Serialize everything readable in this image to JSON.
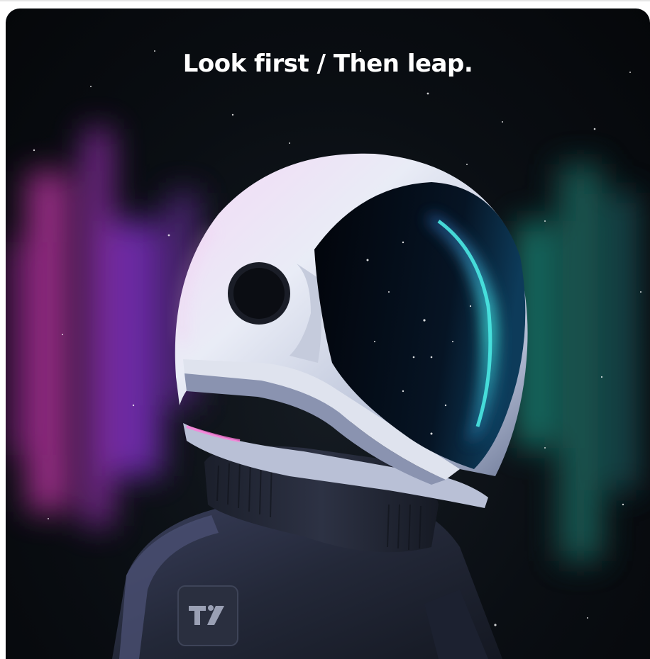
{
  "headline": "Look first / Then leap.",
  "colors": {
    "background": "#0a0e13",
    "aurora_left": "#b0309a",
    "aurora_mid": "#7a2fbd",
    "aurora_right": "#1f8a7a",
    "helmet": "#e8ecf5",
    "visor": "#04070c",
    "visor_rim": "#2fd6d0",
    "suit": "#2c3244"
  },
  "icons": {
    "logo": "tradingview-logo-icon"
  }
}
